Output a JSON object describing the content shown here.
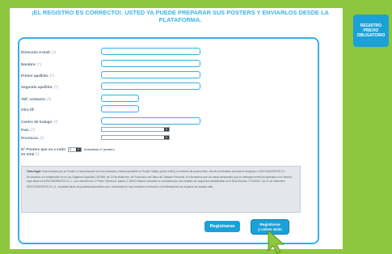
{
  "headline": "¡EL REGISTRO ES CORRECTO!. USTED YA PUEDE PREPARAR SUS POSTERS Y ENVIARLOS DESDE LA PLATAFORMA.",
  "sidebar_badge": "REGISTRO\nPREVIO\nOBLIGATORIO",
  "colors": {
    "frame": "#8dc63f",
    "accent": "#1ba1d8",
    "border": "#3aaee2",
    "headline": "#3cb4e5"
  },
  "form": {
    "required_mark": "(*)",
    "fields": [
      {
        "label": "Dirección e-mail:",
        "value": ""
      },
      {
        "label": "Nombre:",
        "value": ""
      },
      {
        "label": "Primer apellido:",
        "value": ""
      },
      {
        "label": "Segundo apellido:",
        "value": ""
      },
      {
        "label": "Telf. contacto:",
        "value": ""
      },
      {
        "label": "Otro tlf:",
        "value": ""
      },
      {
        "label": "Centro de trabajo:",
        "value": ""
      }
    ],
    "selects": [
      {
        "label": "País:",
        "value": ""
      },
      {
        "label": "Provincia:",
        "value": ""
      }
    ],
    "posters": {
      "label": "Nº Posters que va a subir en total",
      "value": "0",
      "note": "Actualizar nº posters"
    }
  },
  "legal": {
    "p1_bold": "Texto legal:",
    "p1": " Usted acepta que su Poster o Comunicación se a ser revisado y estará accesible en Poster Gallery (Aula Online) en Internet de acceso libre, siendo los titulares del aula el congreso o DISCONGRESOS S.L.",
    "p2": "De acuerdo a lo establecido en la Ley Orgánica Española 15/1999, de 13 de diciembre, de Protección de Datos de Carácter Personal, le informamos que los datos personales que se obtengan serán incorporados a un fichero, cuyo titular es DISCONGRESOS S.L.L. con domicilio en C/ Pedro Teixeira 8, planta 3, 28020 Madrid, tomando en consideración las medidas de seguridad establecidas en el Real Decreto 1720/2007, de 21 de diciembre.",
    "p3": "DISCONGRESOS S.L.U., sociedad titular de postersessiononline.com, mantendrá en todo momento el derecho a la intimidad de los usuarios de nuestra web."
  },
  "buttons": {
    "register": "Registrarse",
    "register_return": "Registrarse\ny volver atrás"
  }
}
